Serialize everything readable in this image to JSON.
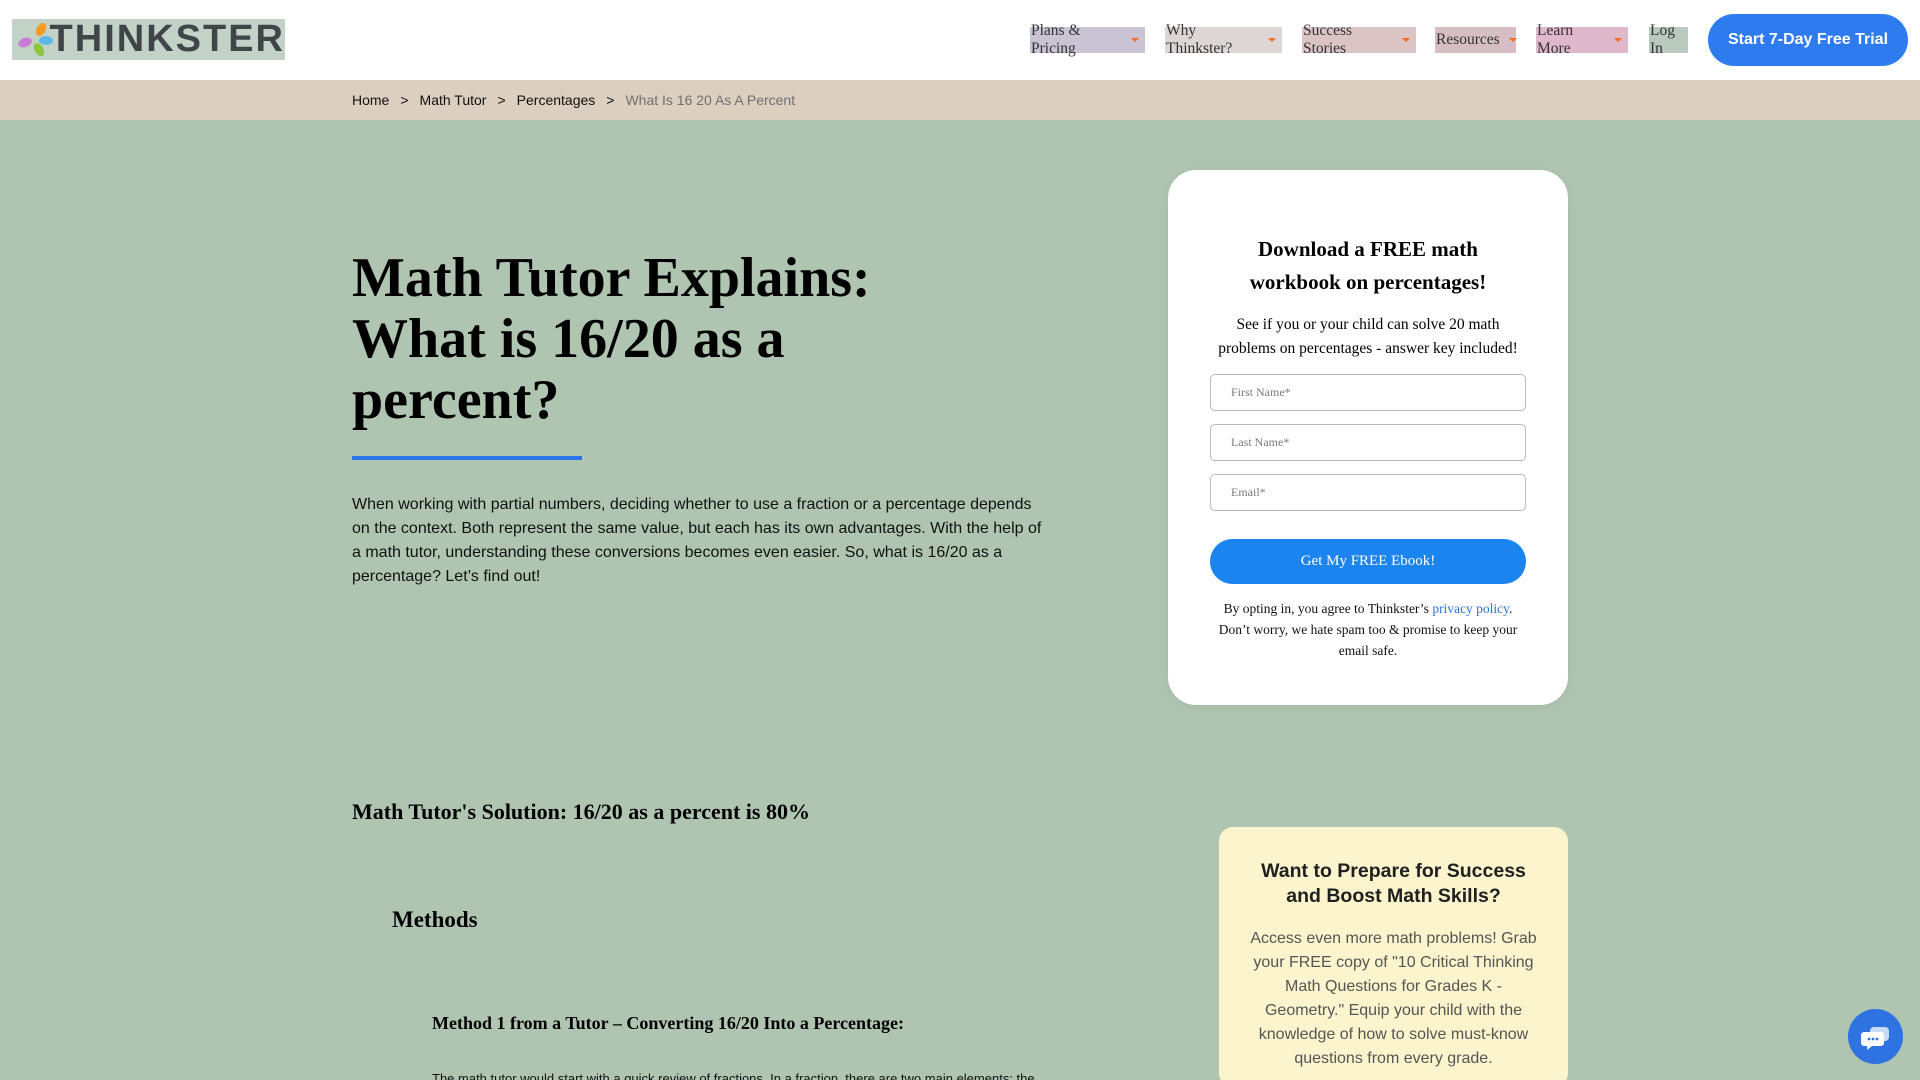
{
  "header": {
    "logo_text": "THINKSTER",
    "nav": [
      {
        "label": "Plans & Pricing"
      },
      {
        "label": "Why Thinkster?"
      },
      {
        "label": "Success Stories"
      },
      {
        "label": "Resources"
      },
      {
        "label": "Learn More"
      }
    ],
    "login_label": "Log In",
    "trial_label": "Start 7-Day Free Trial"
  },
  "breadcrumb": {
    "items": [
      "Home",
      "Math Tutor",
      "Percentages"
    ],
    "current": "What Is 16 20 As A Percent",
    "separator": ">"
  },
  "article": {
    "title": "Math Tutor Explains: What is 16/20 as a percent?",
    "intro": "When working with partial numbers, deciding whether to use a fraction or a percentage depends on the context. Both represent the same value, but each has its own advantages. With the help of a math tutor, understanding these conversions becomes even easier. So, what is 16/20 as a percentage? Let’s find out!",
    "solution_heading": "Math Tutor's Solution: 16/20 as a percent is 80%",
    "methods_heading": "Methods",
    "method1_heading": "Method 1 from a Tutor – Converting 16/20 Into a Percentage:",
    "method1_body": "The math tutor would start with a quick review of fractions. In a fraction, there are two main elements: the"
  },
  "form": {
    "title": "Download a FREE math workbook on percentages!",
    "subtitle": "See if you or your child can solve 20 math problems on percentages - answer key included!",
    "first_name_placeholder": "First Name*",
    "last_name_placeholder": "Last Name*",
    "email_placeholder": "Email*",
    "submit_label": "Get My FREE Ebook!",
    "legal_prefix": "By opting in, you agree to Thinkster’s ",
    "legal_link": "privacy policy",
    "legal_suffix": ". Don’t worry, we hate spam too & promise to keep your email safe."
  },
  "promo": {
    "title": "Want to Prepare for Success and Boost Math Skills?",
    "body": "Access even more math problems! Grab your FREE copy of \"10 Critical Thinking Math Questions for Grades K - Geometry.\" Equip your child with the knowledge of how to solve must-know questions from every grade."
  },
  "colors": {
    "page_bg": "#afc5b2",
    "breadcrumb_bg": "#dccfbf",
    "accent_blue": "#2e7bf0",
    "promo_bg": "#fcf4cd",
    "caret_orange": "#f26b21"
  },
  "icons": {
    "chat": "chat-bubble-icon",
    "nav_caret": "caret-down-icon"
  }
}
